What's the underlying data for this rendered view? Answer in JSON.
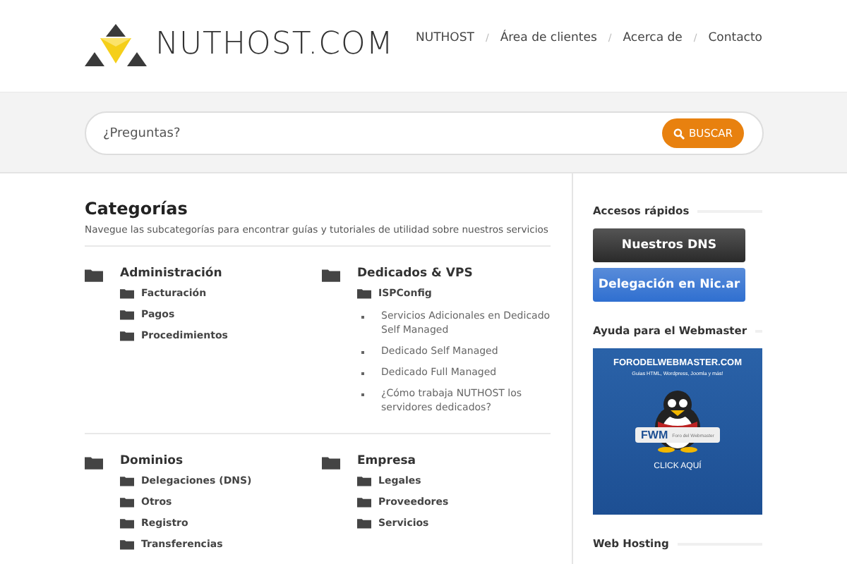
{
  "header": {
    "logo": "NUTHOST.COM",
    "nav": [
      {
        "label": "NUTHOST",
        "separator": "/"
      },
      {
        "label": "Área de clientes",
        "separator": "/"
      },
      {
        "label": "Acerca de",
        "separator": "/"
      },
      {
        "label": "Contacto"
      }
    ]
  },
  "search": {
    "placeholder": "¿Preguntas?",
    "button": "BUSCAR"
  },
  "main": {
    "title": "Categorías",
    "description": "Navegue las subcategorías para encontrar guías y tutoriales de utilidad sobre nuestros servicios",
    "sections": [
      {
        "categories": [
          {
            "name": "Administración",
            "children": [
              {
                "kind": "folder",
                "label": "Facturación"
              },
              {
                "kind": "folder",
                "label": "Pagos"
              },
              {
                "kind": "folder",
                "label": "Procedimientos"
              }
            ]
          },
          {
            "name": "Dedicados & VPS",
            "children": [
              {
                "kind": "folder",
                "label": "ISPConfig"
              },
              {
                "kind": "article",
                "label": "Servicios Adicionales en Dedicado Self Managed"
              },
              {
                "kind": "article",
                "label": "Dedicado Self Managed"
              },
              {
                "kind": "article",
                "label": "Dedicado Full Managed"
              },
              {
                "kind": "article",
                "label": "¿Cómo trabaja NUTHOST los servidores dedicados?"
              }
            ]
          }
        ]
      },
      {
        "categories": [
          {
            "name": "Dominios",
            "children": [
              {
                "kind": "folder",
                "label": "Delegaciones (DNS)"
              },
              {
                "kind": "folder",
                "label": "Otros"
              },
              {
                "kind": "folder",
                "label": "Registro"
              },
              {
                "kind": "folder",
                "label": "Transferencias"
              }
            ]
          },
          {
            "name": "Empresa",
            "children": [
              {
                "kind": "folder",
                "label": "Legales"
              },
              {
                "kind": "folder",
                "label": "Proveedores"
              },
              {
                "kind": "folder",
                "label": "Servicios"
              }
            ]
          }
        ]
      }
    ]
  },
  "sidebar": [
    {
      "kind": "buttons",
      "title": "Accesos rápidos",
      "buttons": [
        {
          "label": "Nuestros DNS",
          "color": "#2a2a2a"
        },
        {
          "label": "Delegación en Nic.ar",
          "color": "#2f6fd0"
        }
      ]
    },
    {
      "kind": "banner",
      "title": "Ayuda para el Webmaster",
      "banner": {
        "site": "FORODELWEBMASTER.COM",
        "tagline": "Guias HTML, Wordpress, Joomla y más!",
        "badge": "FWM",
        "badge_caption": "Foro del Webmaster",
        "cta": "CLICK AQUÍ"
      }
    },
    {
      "kind": "heading",
      "title": "Web Hosting"
    }
  ]
}
